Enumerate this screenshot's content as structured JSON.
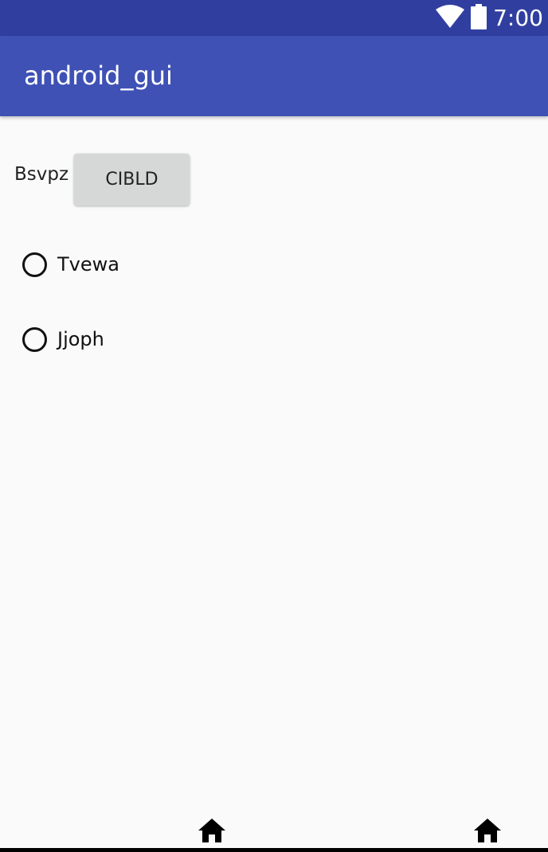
{
  "status_bar": {
    "time": "7:00",
    "icons": [
      "wifi-icon",
      "battery-icon"
    ],
    "color": "#303f9f"
  },
  "app_bar": {
    "title": "android_gui",
    "color": "#3f51b5"
  },
  "content": {
    "label": "Bsvpz",
    "button_label": "CIBLD",
    "radio_options": [
      {
        "label": "Tvewa",
        "checked": false
      },
      {
        "label": "Jjoph",
        "checked": false
      }
    ]
  },
  "nav_bar": {
    "icons": [
      "home-icon",
      "home-icon"
    ]
  }
}
